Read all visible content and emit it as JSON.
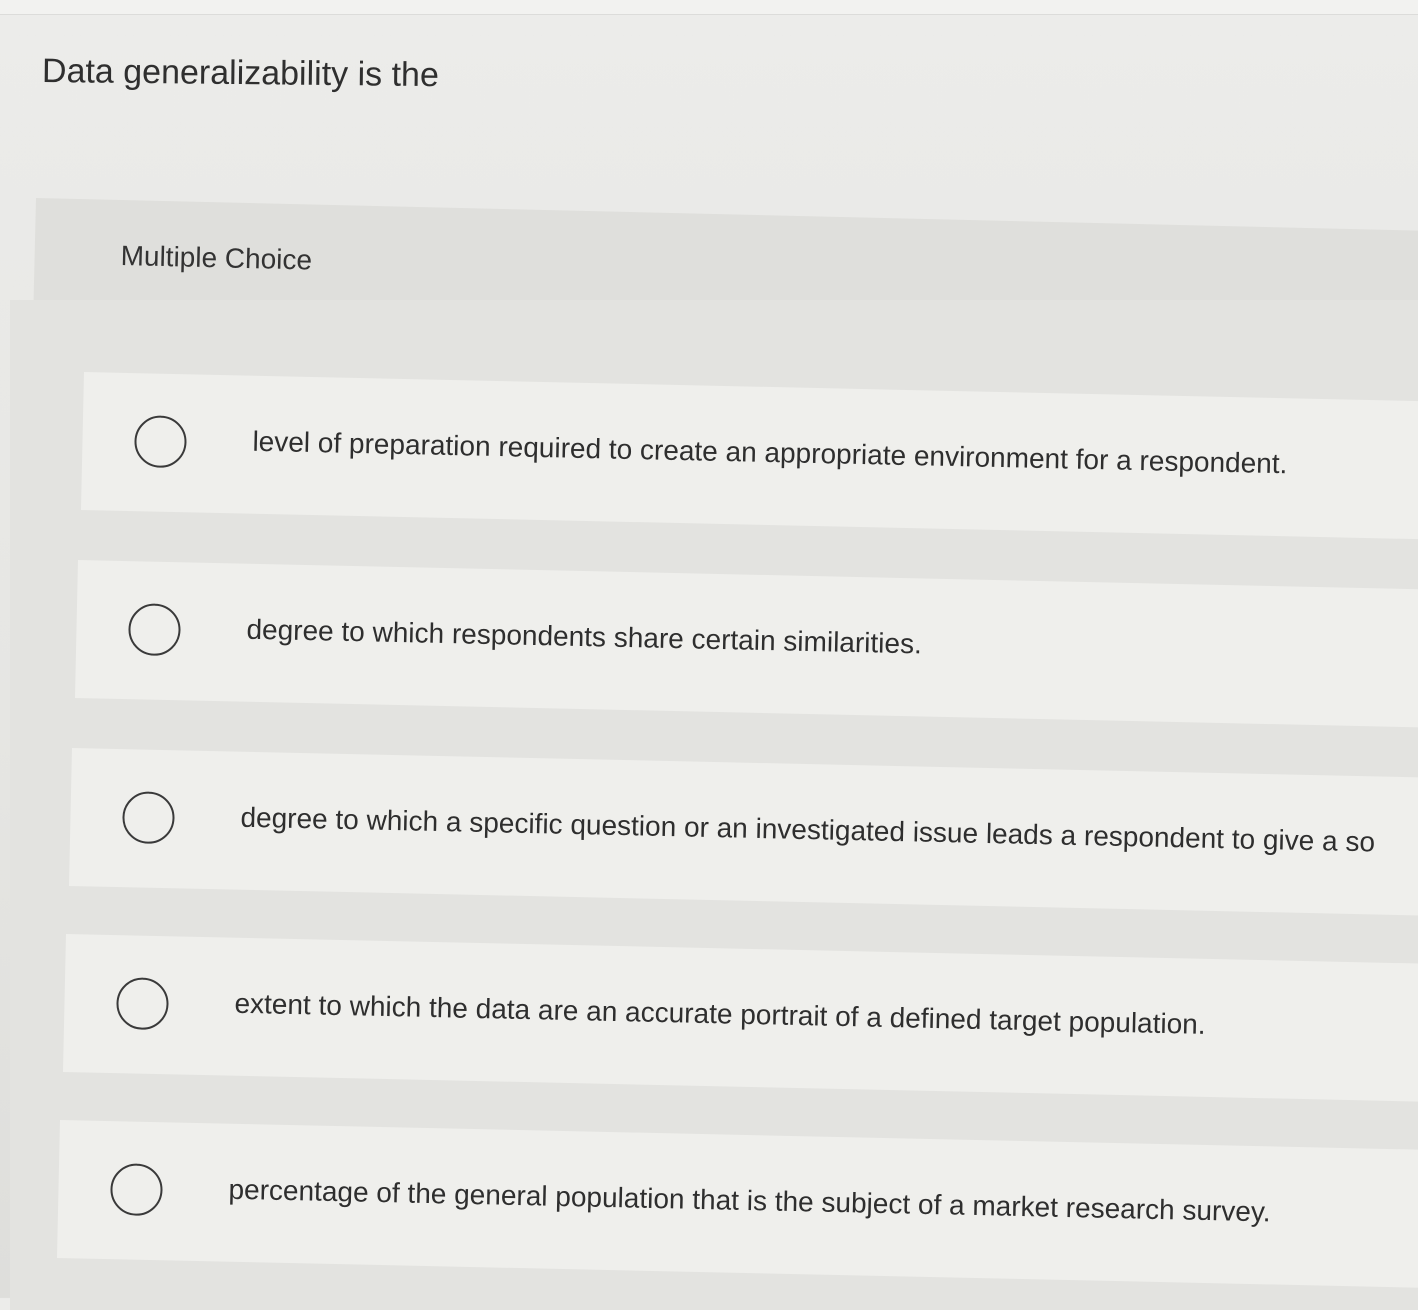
{
  "question": {
    "text": "Data generalizability is the"
  },
  "section": {
    "label": "Multiple Choice"
  },
  "choices": [
    {
      "label": "level of preparation required to create an appropriate environment for a respondent."
    },
    {
      "label": "degree to which respondents share certain similarities."
    },
    {
      "label": "degree to which a specific question or an investigated issue leads a respondent to give a so"
    },
    {
      "label": "extent to which the data are an accurate portrait of a defined target population."
    },
    {
      "label": "percentage of the general population that is the subject of a market research survey."
    }
  ]
}
